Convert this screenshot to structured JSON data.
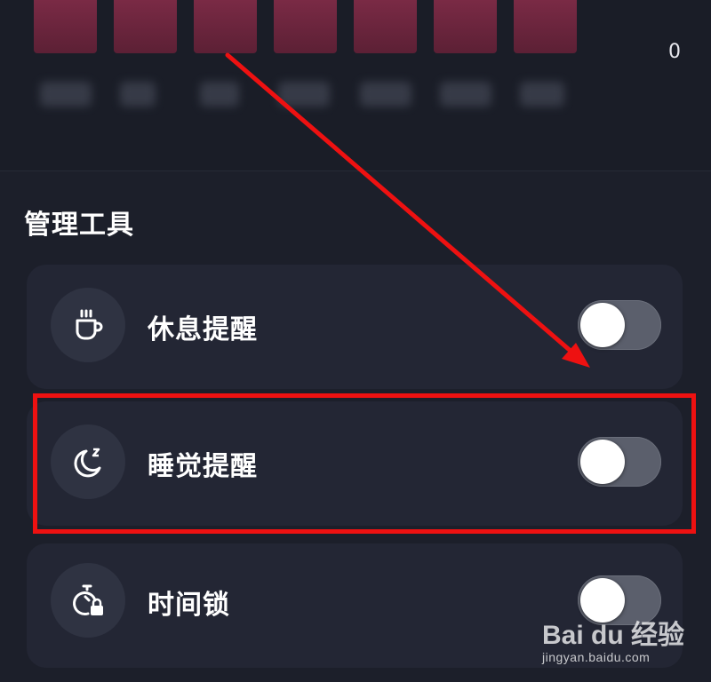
{
  "chart": {
    "axis_value_label": "0",
    "bar_count": 7
  },
  "section": {
    "title": "管理工具"
  },
  "rows": [
    {
      "label": "休息提醒",
      "icon": "coffee-cup-icon",
      "toggle_on": false
    },
    {
      "label": "睡觉提醒",
      "icon": "moon-sleep-icon",
      "toggle_on": false
    },
    {
      "label": "时间锁",
      "icon": "timer-lock-icon",
      "toggle_on": false
    }
  ],
  "annotation": {
    "color": "#ee1111"
  },
  "watermark": {
    "brand": "Bai du 经验",
    "url": "jingyan.baidu.com"
  }
}
